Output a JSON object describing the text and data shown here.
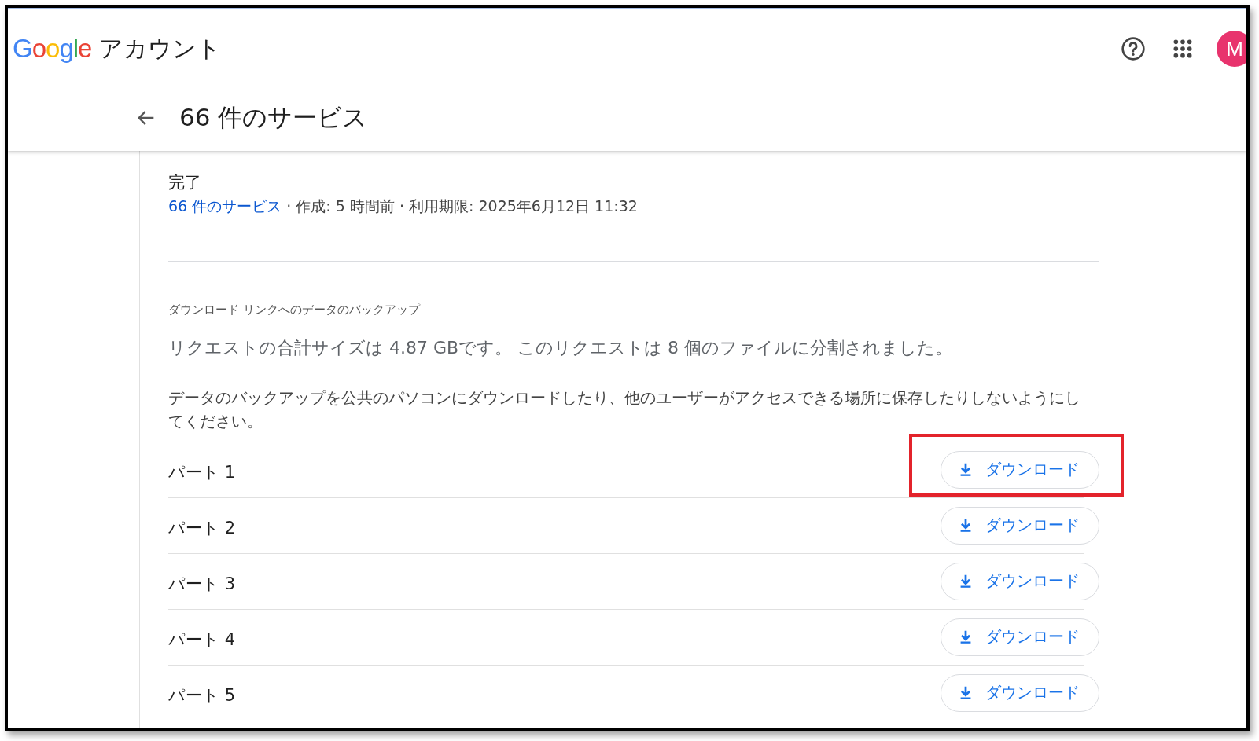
{
  "header": {
    "logo": "Google",
    "product": "アカウント",
    "avatar_letter": "M"
  },
  "page_title": "66 件のサービス",
  "export": {
    "status": "完了",
    "services_link": "66 件のサービス",
    "details": " · 作成: 5 時間前 · 利用期限: 2025年6月12日 11:32"
  },
  "section_label": "ダウンロード リンクへのデータのバックアップ",
  "size_text": "リクエストの合計サイズは 4.87 GBです。 このリクエストは 8 個のファイルに分割されました。",
  "warning": "データのバックアップを公共のパソコンにダウンロードしたり、他のユーザーがアクセスできる場所に保存したりしないようにしてください。",
  "parts": [
    {
      "label": "パート 1",
      "button": "ダウンロード",
      "highlighted": true
    },
    {
      "label": "パート 2",
      "button": "ダウンロード",
      "highlighted": false
    },
    {
      "label": "パート 3",
      "button": "ダウンロード",
      "highlighted": false
    },
    {
      "label": "パート 4",
      "button": "ダウンロード",
      "highlighted": false
    },
    {
      "label": "パート 5",
      "button": "ダウンロード",
      "highlighted": false
    }
  ]
}
